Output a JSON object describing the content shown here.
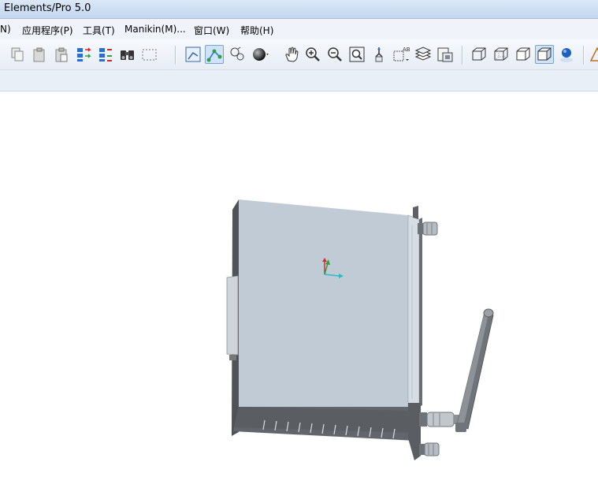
{
  "window": {
    "title": "Elements/Pro 5.0"
  },
  "menu": {
    "items": [
      {
        "label": "N)"
      },
      {
        "label": "应用程序(P)"
      },
      {
        "label": "工具(T)"
      },
      {
        "label": "Manikin(M)..."
      },
      {
        "label": "窗口(W)"
      },
      {
        "label": "帮助(H)"
      }
    ]
  },
  "toolbar": {
    "icons": [
      "copy-icon",
      "paste-icon",
      "paste-special-icon",
      "regenerate-icon",
      "regenerate-manager-icon",
      "find-icon",
      "select-box-icon",
      "sketch-view-icon",
      "datum-display-icon",
      "spin-center-icon",
      "appearance-sphere-icon",
      "pan-hand-icon",
      "zoom-in-icon",
      "zoom-out-icon",
      "refit-icon",
      "reorient-icon",
      "saved-views-icon",
      "layers-icon",
      "view-manager-icon",
      "wireframe-icon",
      "hidden-line-icon",
      "no-hidden-icon",
      "shading-icon",
      "model-tree-icon",
      "datum-plane-icon"
    ]
  },
  "colors": {
    "accent": "#7da2ce",
    "model_face": "#c0cbd6",
    "model_dark": "#5e6268"
  }
}
